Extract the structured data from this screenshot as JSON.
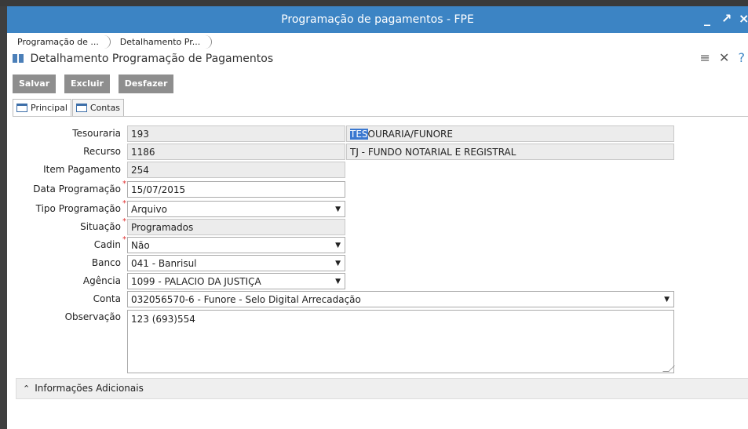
{
  "window": {
    "title": "Programação de pagamentos - FPE",
    "controls": {
      "minimize": "_",
      "maximize": "↗",
      "close": "×"
    }
  },
  "breadcrumb": [
    "Programação de ...",
    "Detalhamento Pr..."
  ],
  "page_title": "Detalhamento Programação de Pagamentos",
  "header_icons": {
    "menu": "≡",
    "tools": "✕",
    "help": "?"
  },
  "toolbar": {
    "save": "Salvar",
    "delete": "Excluir",
    "undo": "Desfazer"
  },
  "tabs": [
    {
      "label": "Principal",
      "active": true
    },
    {
      "label": "Contas",
      "active": false
    }
  ],
  "form": {
    "tesouraria": {
      "label": "Tesouraria",
      "code": "193",
      "desc_highlight": "TES",
      "desc_rest": "OURARIA/FUNORE"
    },
    "recurso": {
      "label": "Recurso",
      "code": "1186",
      "desc": "TJ - FUNDO NOTARIAL E REGISTRAL"
    },
    "item_pagamento": {
      "label": "Item Pagamento",
      "value": "254"
    },
    "data_programacao": {
      "label": "Data Programação",
      "value": "15/07/2015"
    },
    "tipo_programacao": {
      "label": "Tipo Programação",
      "value": "Arquivo"
    },
    "situacao": {
      "label": "Situação",
      "value": "Programados"
    },
    "cadin": {
      "label": "Cadin",
      "value": "Não"
    },
    "banco": {
      "label": "Banco",
      "value": "041 - Banrisul"
    },
    "agencia": {
      "label": "Agência",
      "value": "1099 - PALACIO DA JUSTIÇA"
    },
    "conta": {
      "label": "Conta",
      "value": "032056570-6 - Funore - Selo Digital Arrecadação"
    },
    "observacao": {
      "label": "Observação",
      "value": "123 (693)554"
    }
  },
  "required_mark": "*",
  "select_arrow": "▼",
  "additional_info": {
    "label": "Informações Adicionais",
    "chevron": "⌃"
  }
}
